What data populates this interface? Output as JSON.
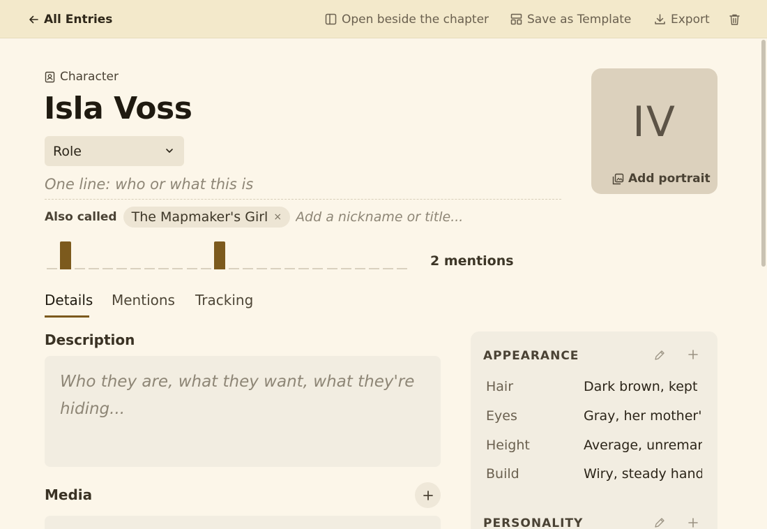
{
  "topbar": {
    "back_label": "All Entries",
    "open_beside_label": "Open beside the chapter",
    "save_template_label": "Save as Template",
    "export_label": "Export"
  },
  "entry": {
    "type_label": "Character",
    "name": "Isla Voss",
    "role_label": "Role",
    "oneline_placeholder": "One line: who or what this is",
    "also_called_label": "Also called",
    "aliases": [
      "The Mapmaker's Girl"
    ],
    "alias_remove_glyph": "×",
    "nickname_placeholder": "Add a nickname or title...",
    "mention_count_label": "2 mentions",
    "mention_strip": [
      0,
      1,
      0,
      0,
      0,
      0,
      0,
      0,
      0,
      0,
      0,
      0,
      1,
      0,
      0,
      0,
      0,
      0,
      0,
      0,
      0,
      0,
      0,
      0,
      0,
      0
    ]
  },
  "portrait": {
    "initials": "IV",
    "add_label": "Add portrait"
  },
  "tabs": [
    {
      "label": "Details",
      "active": true
    },
    {
      "label": "Mentions",
      "active": false
    },
    {
      "label": "Tracking",
      "active": false
    }
  ],
  "details": {
    "description_label": "Description",
    "description_placeholder": "Who they are, what they want, what they're hiding...",
    "media_label": "Media"
  },
  "appearance": {
    "heading": "APPEARANCE",
    "rows": [
      {
        "key": "Hair",
        "value": "Dark brown, kept short"
      },
      {
        "key": "Eyes",
        "value": "Gray, her mother's"
      },
      {
        "key": "Height",
        "value": "Average, unremarkable"
      },
      {
        "key": "Build",
        "value": "Wiry, steady hands"
      }
    ]
  },
  "personality": {
    "heading": "PERSONALITY"
  },
  "colors": {
    "accent": "#7c5a1d",
    "topbar_bg": "#f3e9cb",
    "page_bg": "#fcf6e9"
  }
}
